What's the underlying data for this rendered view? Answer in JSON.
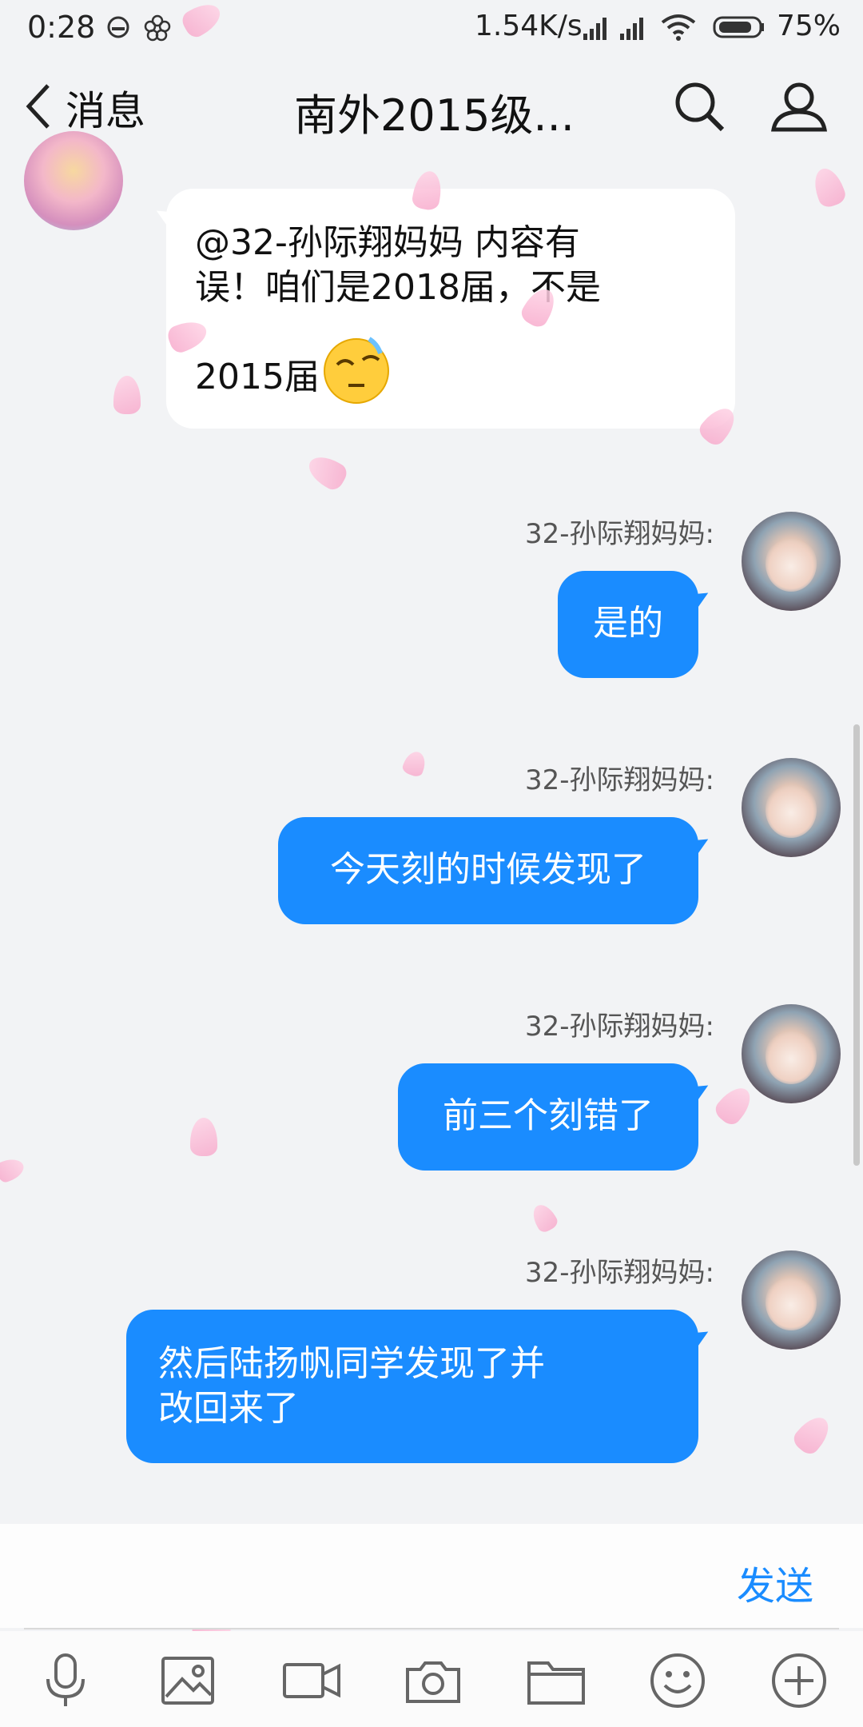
{
  "status_bar": {
    "time": "0:28",
    "net_speed": "1.54K/s",
    "battery": "75%"
  },
  "header": {
    "back_label": "消息",
    "title": "南外2015级..."
  },
  "messages": [
    {
      "direction": "in",
      "text_line1": "@32-孙际翔妈妈 内容有",
      "text_line2": "误！咱们是2018届，不是",
      "text_line3": "2015届"
    },
    {
      "direction": "out",
      "sender": "32-孙际翔妈妈:",
      "text": "是的"
    },
    {
      "direction": "out",
      "sender": "32-孙际翔妈妈:",
      "text": "今天刻的时候发现了"
    },
    {
      "direction": "out",
      "sender": "32-孙际翔妈妈:",
      "text": "前三个刻错了"
    },
    {
      "direction": "out",
      "sender": "32-孙际翔妈妈:",
      "text_line1": "然后陆扬帆同学发现了并",
      "text_line2": "改回来了"
    }
  ],
  "input": {
    "send_label": "发送"
  },
  "colors": {
    "accent": "#1a8cff",
    "background": "#f2f3f5",
    "incoming_bubble": "#ffffff",
    "outgoing_bubble": "#1a8cff"
  },
  "toolbar": {
    "icons": [
      "microphone-icon",
      "image-icon",
      "video-icon",
      "camera-icon",
      "folder-icon",
      "emoji-icon",
      "plus-icon"
    ]
  }
}
